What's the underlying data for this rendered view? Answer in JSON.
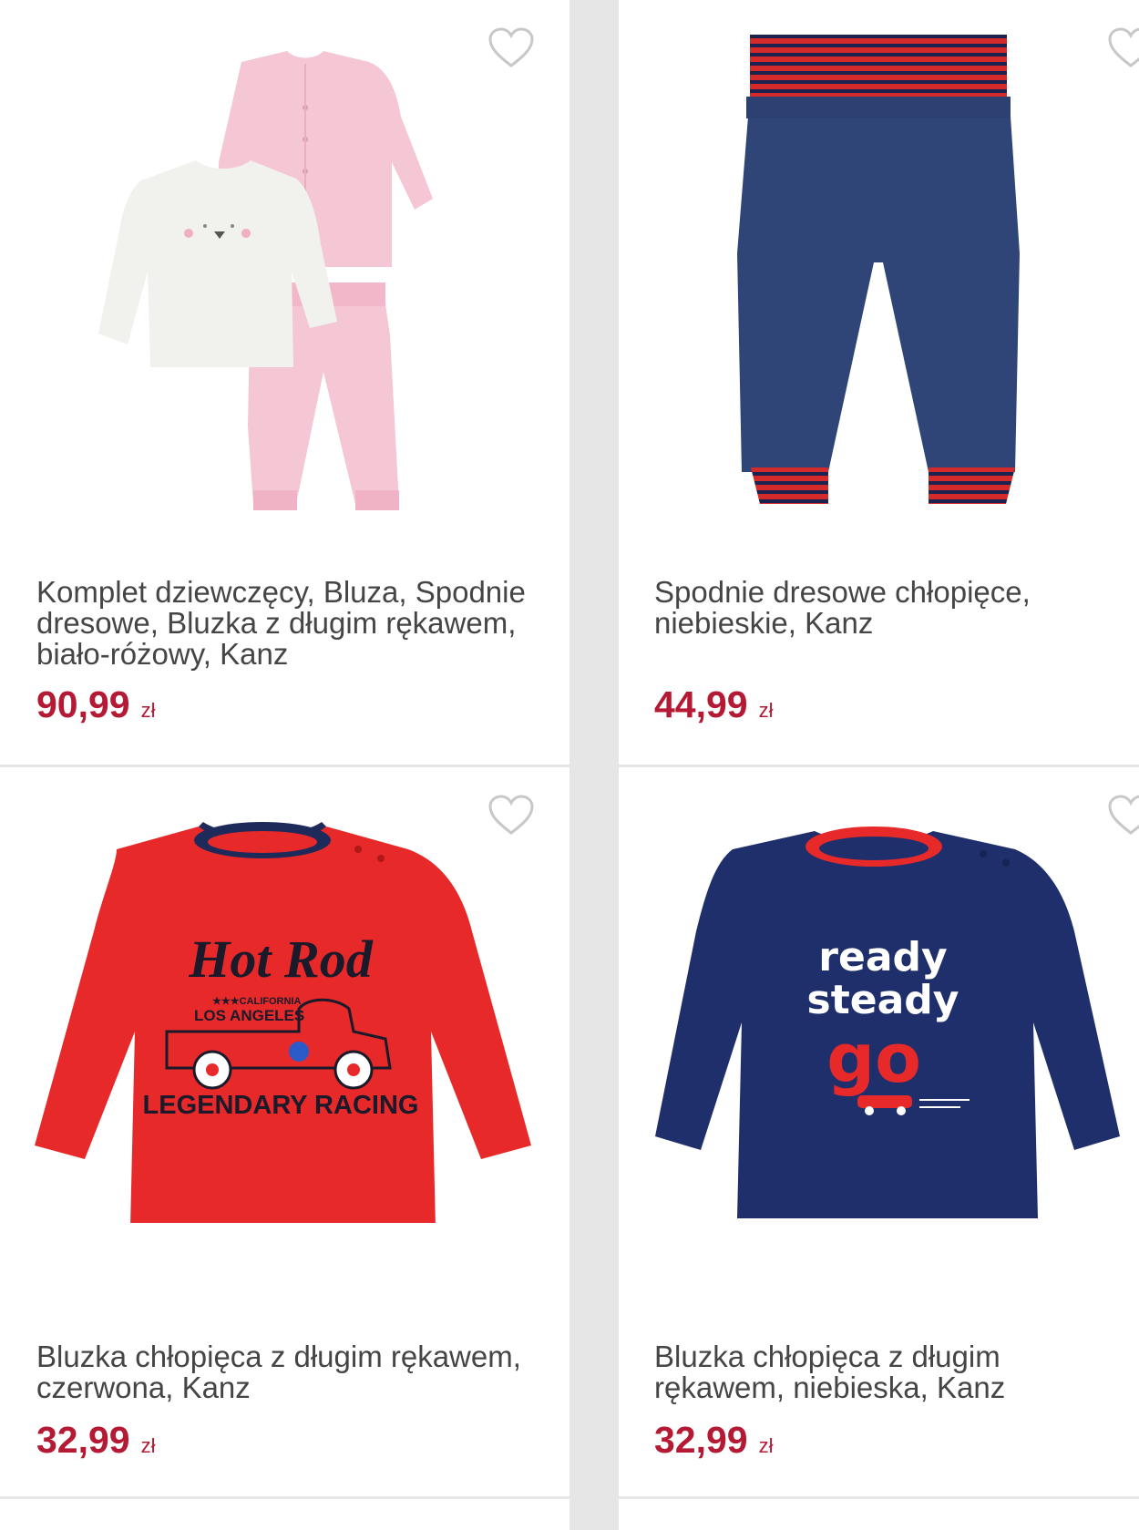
{
  "products": [
    {
      "title": "Komplet dziewczęcy, Bluza, Spodnie dresowe, Bluzka z długim rękawem, biało-różowy, Kanz",
      "price": "90,99",
      "currency": "zł",
      "image_icon": "girls-set-image"
    },
    {
      "title": "Spodnie dresowe chłopięce, niebieskie, Kanz",
      "price": "44,99",
      "currency": "zł",
      "image_icon": "sweatpants-image"
    },
    {
      "title": "Bluzka chłopięca z długim rękawem, czerwona, Kanz",
      "price": "32,99",
      "currency": "zł",
      "image_icon": "red-shirt-image",
      "print_text": [
        "Hot Rod",
        "★★★CALIFORNIA",
        "LOS ANGELES",
        "LEGENDARY RACING"
      ]
    },
    {
      "title": "Bluzka chłopięca z długim rękawem, niebieska, Kanz",
      "price": "32,99",
      "currency": "zł",
      "image_icon": "navy-shirt-image",
      "print_text": [
        "ready",
        "steady",
        "go"
      ]
    }
  ],
  "colors": {
    "price": "#b51a35",
    "title": "#454545",
    "background": "#e6e6e6",
    "card": "#ffffff"
  },
  "favorite_icon": "heart-outline-icon"
}
